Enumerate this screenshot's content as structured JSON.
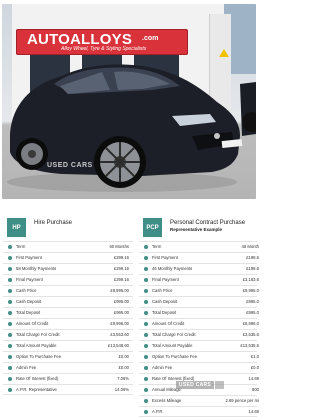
{
  "photo": {
    "store_sign": {
      "brand": "AUTOALLOYS",
      "domain": ".com",
      "tagline": "Alloy Wheel, Tyre & Styling Specialists"
    },
    "watermark": "USED CARS"
  },
  "hire_purchase": {
    "badge": "HP",
    "title": "Hire Purchase",
    "rows": [
      {
        "label": "Term",
        "value": "60 Months"
      },
      {
        "label": "First Payment",
        "value": "£299.16"
      },
      {
        "label": "58 Monthly Payments",
        "value": "£299.16"
      },
      {
        "label": "Final Payment",
        "value": "£299.16"
      },
      {
        "label": "Cash Price",
        "value": "£9,995.00"
      },
      {
        "label": "Cash Deposit",
        "value": "£995.00"
      },
      {
        "label": "Total Deposit",
        "value": "£995.00"
      },
      {
        "label": "Amount Of Credit",
        "value": "£9,996.00"
      },
      {
        "label": "Total Charge For Credit",
        "value": "£3,553.60"
      },
      {
        "label": "Total Amount Payable",
        "value": "£13,548.60"
      },
      {
        "label": "Option To Purchase Fee",
        "value": "£0.00"
      },
      {
        "label": "Admin Fee",
        "value": "£0.00"
      },
      {
        "label": "Rate Of Interest (fixed)",
        "value": "7.06%"
      },
      {
        "label": "A.P.R. Representative",
        "value": "14.06%"
      }
    ]
  },
  "pcp": {
    "badge": "PCP",
    "title": "Personal Contract Purchase",
    "subtitle": "Representative Example",
    "rows": [
      {
        "label": "Term",
        "value": "48 Month"
      },
      {
        "label": "First Payment",
        "value": "£198.6"
      },
      {
        "label": "46 Monthly Payments",
        "value": "£198.6"
      },
      {
        "label": "Final Payment",
        "value": "£3,183.6"
      },
      {
        "label": "Cash Price",
        "value": "£9,995.0"
      },
      {
        "label": "Cash Deposit",
        "value": "£995.0"
      },
      {
        "label": "Total Deposit",
        "value": "£995.0"
      },
      {
        "label": "Amount Of Credit",
        "value": "£8,996.0"
      },
      {
        "label": "Total Charge For Credit",
        "value": "£3,535.6"
      },
      {
        "label": "Total Amount Payable",
        "value": "£13,535.6"
      },
      {
        "label": "Option To Purchase Fee",
        "value": "£1.0"
      },
      {
        "label": "Admin Fee",
        "value": "£0.0"
      },
      {
        "label": "Rate Of Interest (fixed)",
        "value": "14.69"
      },
      {
        "label": "Annual Mileage",
        "value": "800"
      },
      {
        "label": "Excess Mileage",
        "value": "2.69 pence per mi"
      },
      {
        "label": "A.P.R.",
        "value": "14.69"
      }
    ]
  },
  "table_watermark": "USED CARS",
  "colors": {
    "accent": "#3f8f86",
    "sign_red": "#d9323b"
  }
}
